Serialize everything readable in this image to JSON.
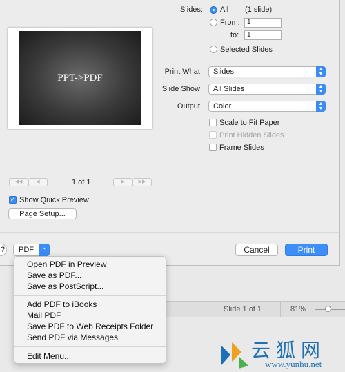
{
  "preview": {
    "slide_text": "PPT->PDF"
  },
  "slides": {
    "label": "Slides:",
    "all_label": "All",
    "all_count": "(1 slide)",
    "from_label": "From:",
    "from_value": "1",
    "to_label": "to:",
    "to_value": "1",
    "selected_label": "Selected Slides"
  },
  "print_what": {
    "label": "Print What:",
    "value": "Slides"
  },
  "slide_show": {
    "label": "Slide Show:",
    "value": "All Slides"
  },
  "output": {
    "label": "Output:",
    "value": "Color"
  },
  "checkboxes": {
    "scale": "Scale to Fit Paper",
    "hidden": "Print Hidden Slides",
    "frame": "Frame Slides"
  },
  "nav": {
    "first": "◀◀",
    "prev": "◀",
    "page": "1 of 1",
    "next": "▶",
    "last": "▶▶"
  },
  "show_quick_preview": "Show Quick Preview",
  "page_setup": "Page Setup...",
  "help": "?",
  "pdf_button": "PDF",
  "pdf_arrow": "⌄",
  "cancel": "Cancel",
  "print": "Print",
  "status_bar": {
    "slide": "Slide 1 of 1",
    "zoom": "81%"
  },
  "menu": {
    "group1": [
      "Open PDF in Preview",
      "Save as PDF...",
      "Save as PostScript..."
    ],
    "group2": [
      "Add PDF to iBooks",
      "Mail PDF",
      "Save PDF to Web Receipts Folder",
      "Send PDF via Messages"
    ],
    "group3": [
      "Edit Menu..."
    ]
  },
  "watermark": {
    "cn": "云狐网",
    "url": "www.yunhu.net"
  },
  "colors": {
    "accent": "#3b8cf5",
    "watermark": "#1d6fb6"
  }
}
